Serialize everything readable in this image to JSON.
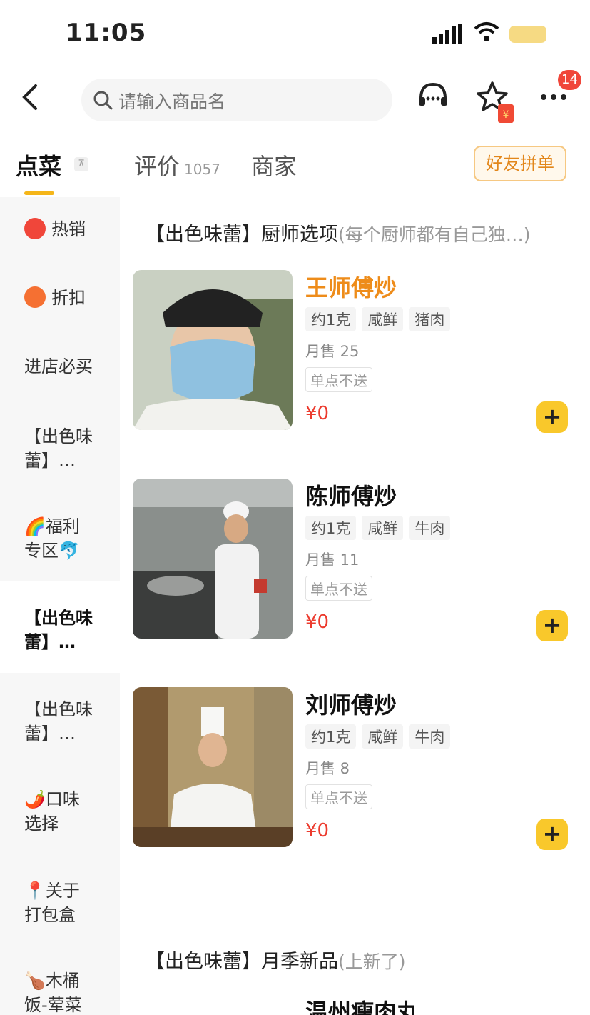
{
  "status_bar": {
    "time": "11:05"
  },
  "nav": {
    "search_placeholder": "请输入商品名",
    "notification_count": "14"
  },
  "tabs": [
    {
      "label": "点菜"
    },
    {
      "label": "评价",
      "count": "1057"
    },
    {
      "label": "商家"
    }
  ],
  "pin_icon_text": "⊼",
  "group_order_label": "好友拼单",
  "sidebar": {
    "items": [
      {
        "label": "热销",
        "icon": "fire-icon"
      },
      {
        "label": "折扣",
        "icon": "discount-icon"
      },
      {
        "label": "进店必买"
      },
      {
        "label": "【出色味蕾】…"
      },
      {
        "label": "🌈福利专区🐬"
      },
      {
        "label": "【出色味蕾】…",
        "active": true
      },
      {
        "label": "【出色味蕾】…"
      },
      {
        "label": "🌶️口味选择"
      },
      {
        "label": "📍关于打包盒"
      },
      {
        "label": "🍗木桶饭-荤菜"
      }
    ]
  },
  "section1": {
    "title": "【出色味蕾】厨师选项",
    "desc": "(每个厨师都有自己独…)"
  },
  "products": [
    {
      "name": "王师傅炒",
      "tags": [
        "约1克",
        "咸鲜",
        "猪肉"
      ],
      "sold": "月售 25",
      "note": "单点不送",
      "price": "¥0",
      "highlight": true
    },
    {
      "name": "陈师傅炒",
      "tags": [
        "约1克",
        "咸鲜",
        "牛肉"
      ],
      "sold": "月售 11",
      "note": "单点不送",
      "price": "¥0"
    },
    {
      "name": "刘师傅炒",
      "tags": [
        "约1克",
        "咸鲜",
        "牛肉"
      ],
      "sold": "月售 8",
      "note": "单点不送",
      "price": "¥0"
    }
  ],
  "add_symbol": "+",
  "section2": {
    "title": "【出色味蕾】月季新品",
    "desc": "(上新了)"
  },
  "next_product": {
    "name": "温州瘦肉丸"
  },
  "colors": {
    "accent": "#f5b619",
    "price": "#ec3b2e",
    "highlight_name": "#ee8c1a",
    "add_button": "#f9c82b"
  }
}
